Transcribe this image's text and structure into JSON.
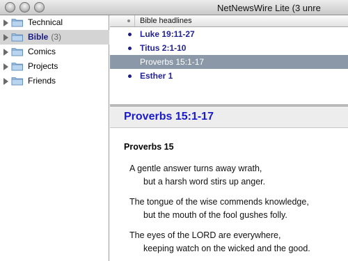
{
  "window": {
    "title": "NetNewsWire Lite (3 unre"
  },
  "sidebar": {
    "folders": [
      {
        "label": "Technical",
        "count": ""
      },
      {
        "label": "Bible",
        "count": "(3)"
      },
      {
        "label": "Comics",
        "count": ""
      },
      {
        "label": "Projects",
        "count": ""
      },
      {
        "label": "Friends",
        "count": ""
      }
    ]
  },
  "headlines": {
    "column_title": "Bible headlines",
    "items": [
      {
        "title": "Luke 19:11-27"
      },
      {
        "title": "Titus 2:1-10"
      },
      {
        "title": "Proverbs 15:1-17"
      },
      {
        "title": "Esther 1"
      }
    ]
  },
  "article": {
    "title": "Proverbs 15:1-17",
    "subtitle": "Proverbs 15",
    "verses": [
      {
        "line1": "A gentle answer turns away wrath,",
        "line2": "but a harsh word stirs up anger."
      },
      {
        "line1": "The tongue of the wise commends knowledge,",
        "line2": "but the mouth of the fool gushes folly."
      },
      {
        "line1": "The eyes of the LORD are everywhere,",
        "line2": "keeping watch on the wicked and the good."
      }
    ]
  },
  "colors": {
    "accent": "#1a1acd",
    "selection": "#8a98a8",
    "unread_dot": "#1d1d86"
  }
}
